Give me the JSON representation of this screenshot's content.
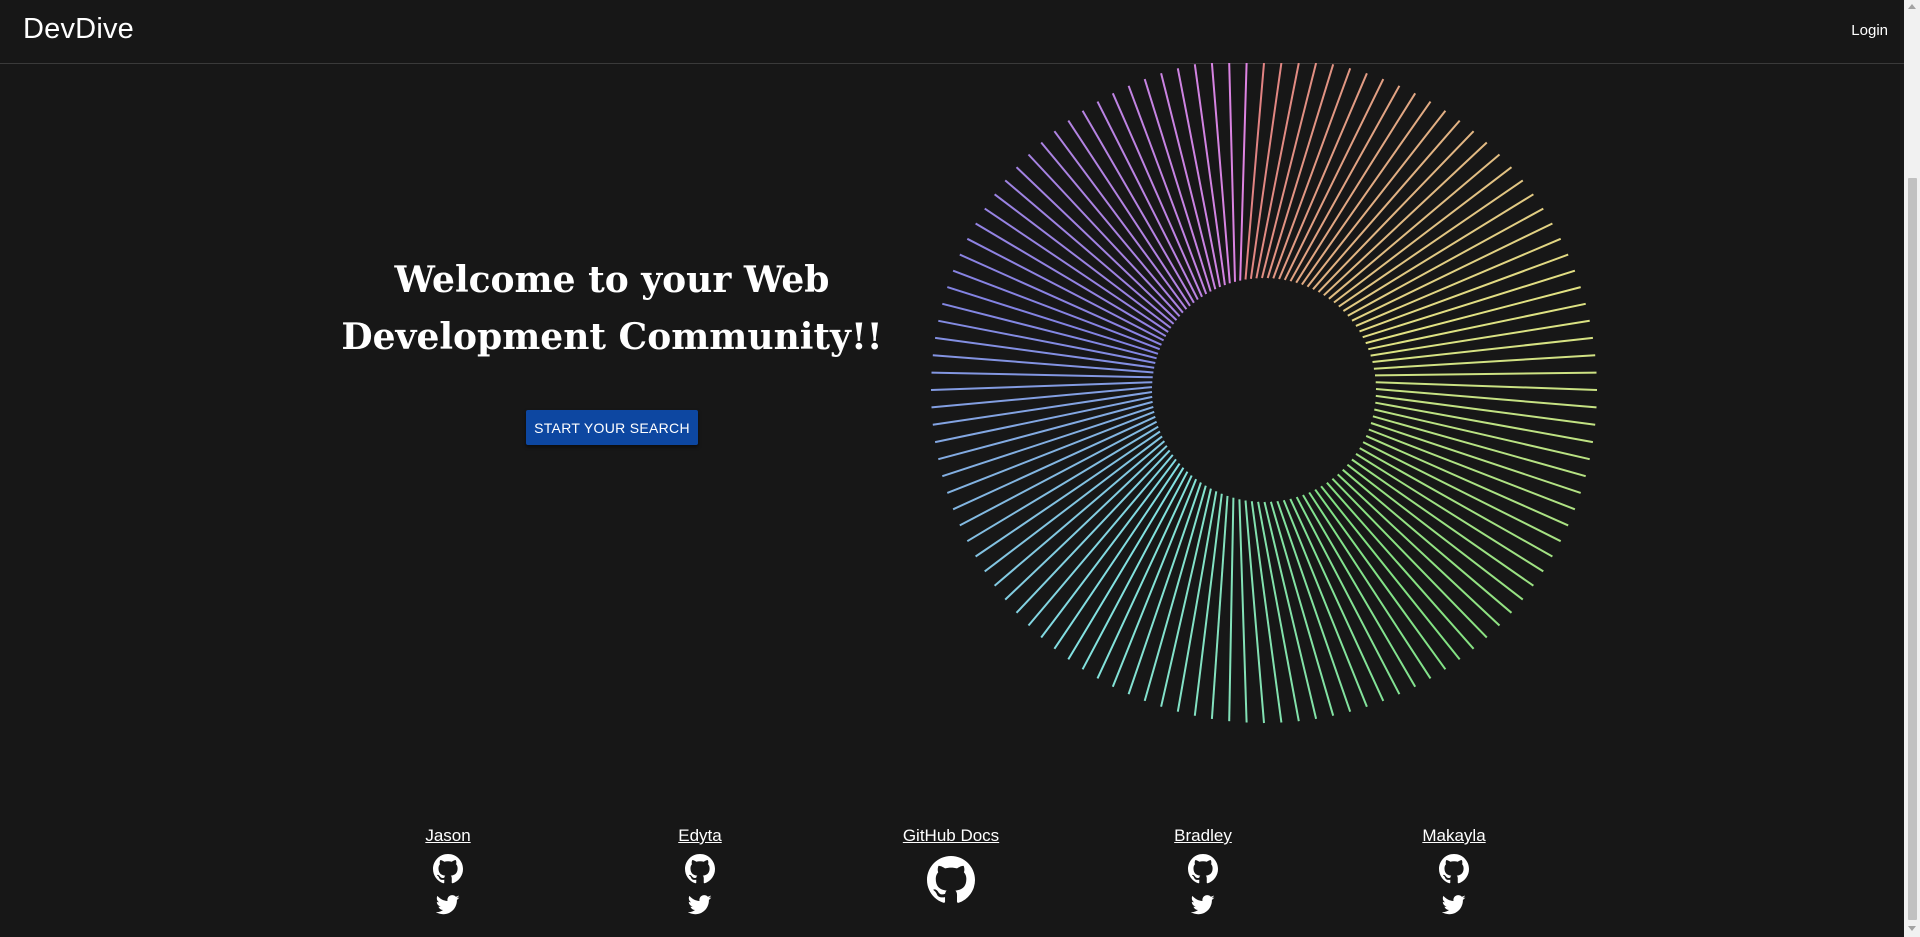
{
  "navbar": {
    "brand": "DevDive",
    "login_label": "Login"
  },
  "hero": {
    "title_line1": "Welcome to your Web",
    "title_line2": "Development Community!!",
    "cta_label": "START YOUR SEARCH",
    "cta_color": "#0d47a1"
  },
  "footer": {
    "links": [
      {
        "label": "Jason",
        "icons": [
          "github-icon",
          "twitter-icon"
        ]
      },
      {
        "label": "Edyta",
        "icons": [
          "github-icon",
          "twitter-icon"
        ]
      },
      {
        "label": "GitHub Docs",
        "icons": [
          "github-icon"
        ]
      },
      {
        "label": "Bradley",
        "icons": [
          "github-icon",
          "twitter-icon"
        ]
      },
      {
        "label": "Makayla",
        "icons": [
          "github-icon",
          "twitter-icon"
        ]
      }
    ]
  },
  "colors": {
    "background": "#171717",
    "text": "#ffffff",
    "navbar_border": "#3a3a3a"
  }
}
